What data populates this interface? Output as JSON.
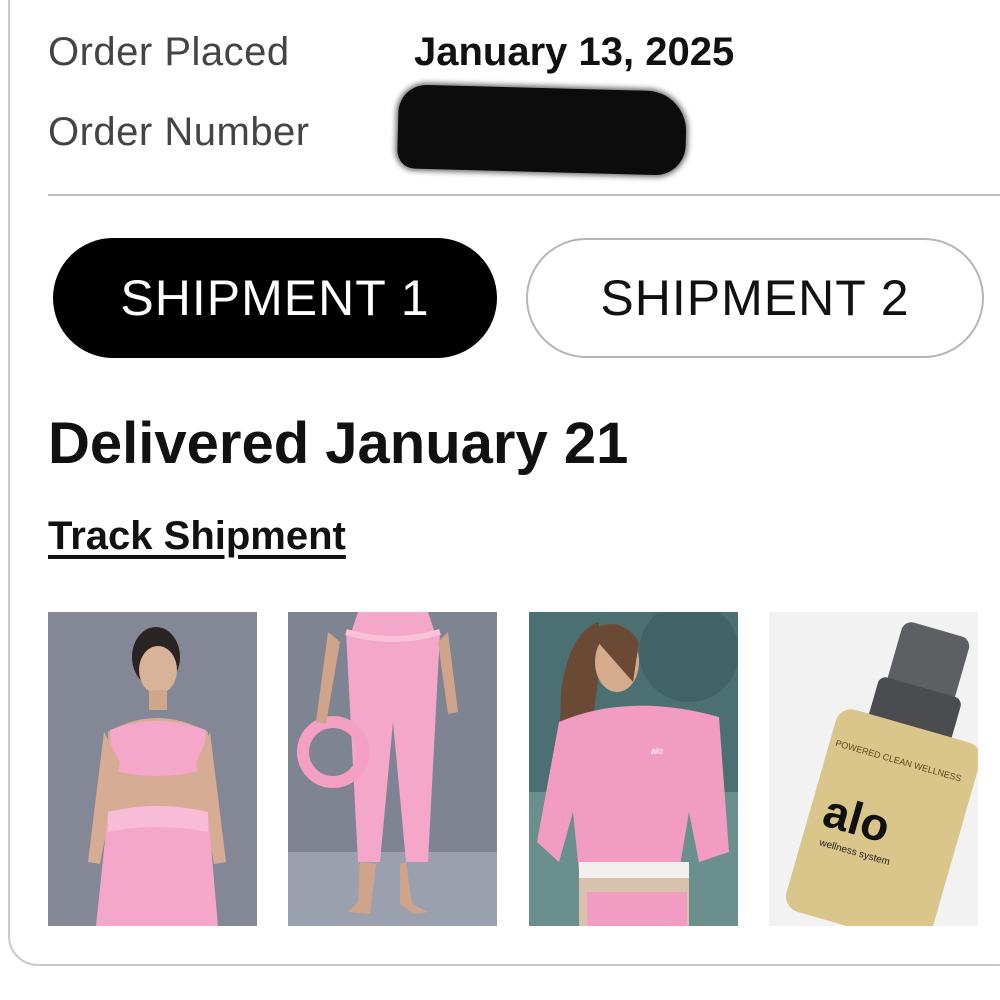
{
  "order": {
    "placed_label": "Order Placed",
    "placed_value": "January 13, 2025",
    "number_label": "Order Number",
    "number_value_visible": "1"
  },
  "tabs": [
    {
      "label": "SHIPMENT 1",
      "active": true
    },
    {
      "label": "SHIPMENT 2",
      "active": false
    }
  ],
  "shipment": {
    "status": "Delivered January 21",
    "track_label": "Track Shipment"
  },
  "products": [
    {
      "image": "model-pink-sports-bra-leggings"
    },
    {
      "image": "model-pink-leggings-with-ring"
    },
    {
      "image": "model-pink-sweatshirt"
    },
    {
      "image": "alo-serum-spray-bottle",
      "brand_text": "alo",
      "sub_text": "wellness system",
      "bottle_text": "POWERED CLEAN WELLNESS"
    }
  ],
  "colors": {
    "accent": "#000000",
    "product_pink": "#f4a7c8"
  }
}
